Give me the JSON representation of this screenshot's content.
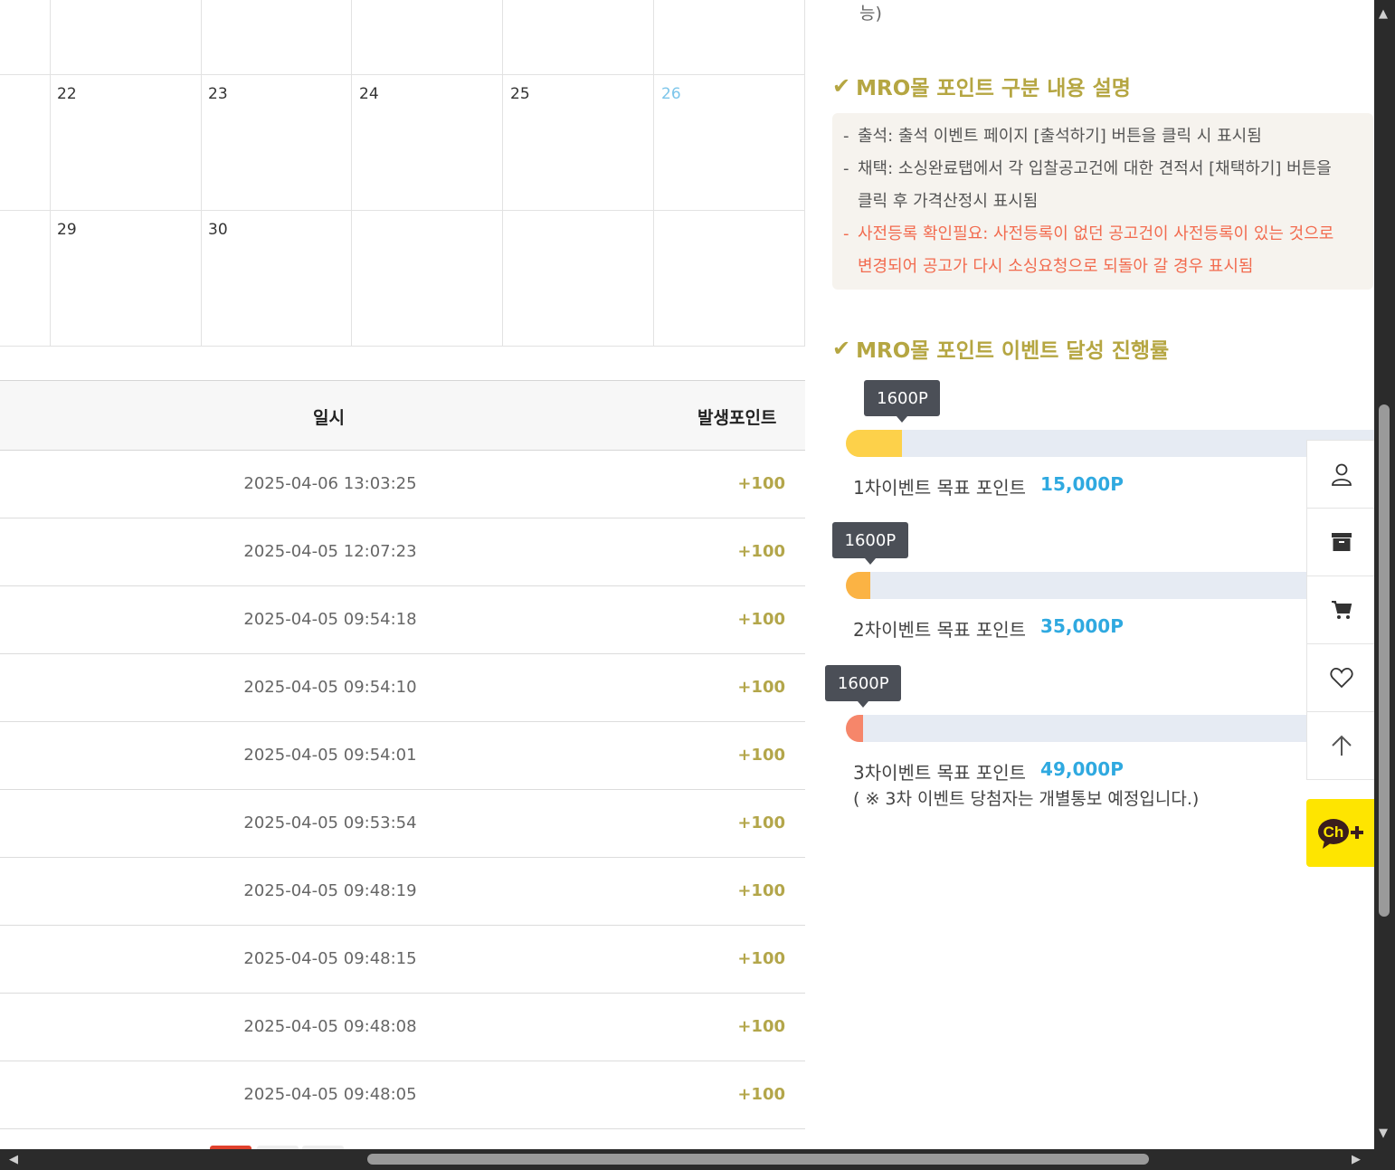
{
  "calendar": {
    "days": [
      "22",
      "23",
      "24",
      "25",
      "26",
      "29",
      "30"
    ]
  },
  "table": {
    "headers": {
      "date": "일시",
      "points": "발생포인트"
    },
    "rows": [
      {
        "date": "2025-04-06 13:03:25",
        "points": "+100"
      },
      {
        "date": "2025-04-05 12:07:23",
        "points": "+100"
      },
      {
        "date": "2025-04-05 09:54:18",
        "points": "+100"
      },
      {
        "date": "2025-04-05 09:54:10",
        "points": "+100"
      },
      {
        "date": "2025-04-05 09:54:01",
        "points": "+100"
      },
      {
        "date": "2025-04-05 09:53:54",
        "points": "+100"
      },
      {
        "date": "2025-04-05 09:48:19",
        "points": "+100"
      },
      {
        "date": "2025-04-05 09:48:15",
        "points": "+100"
      },
      {
        "date": "2025-04-05 09:48:08",
        "points": "+100"
      },
      {
        "date": "2025-04-05 09:48:05",
        "points": "+100"
      }
    ]
  },
  "right": {
    "cut_text": "능)",
    "section1_title": "MRO몰 포인트 구분 내용 설명",
    "desc": [
      {
        "dash": "-",
        "text": "출석: 출석 이벤트 페이지 [출석하기] 버튼을 클릭 시 표시됨"
      },
      {
        "dash": "-",
        "text": "채택: 소싱완료탭에서 각 입찰공고건에 대한 견적서 [채택하기] 버튼을"
      },
      {
        "dash": "",
        "text": "클릭 후 가격산정시 표시됨"
      },
      {
        "dash": "-",
        "text": "사전등록 확인필요: 사전등록이 없던 공고건이 사전등록이 있는 것으로"
      },
      {
        "dash": "",
        "text": "변경되어 공고가 다시 소싱요청으로 되돌아 갈 경우 표시됨"
      }
    ],
    "section2_title": "MRO몰 포인트 이벤트 달성 진행률",
    "events": [
      {
        "tooltip": "1600P",
        "label": "1차이벤트 목표 포인트",
        "goal": "15,000P",
        "progress": 0.107,
        "color": "#fdd14a"
      },
      {
        "tooltip": "1600P",
        "label": "2차이벤트 목표 포인트",
        "goal": "35,000P",
        "progress": 0.046,
        "color": "#fbb344"
      },
      {
        "tooltip": "1600P",
        "label": "3차이벤트 목표 포인트",
        "goal": "49,000P",
        "progress": 0.033,
        "color": "#f6866a"
      }
    ],
    "note": "( ※ 3차 이벤트 당첨자는 개별통보 예정입니다.)"
  },
  "quick_menu": [
    "user-icon",
    "archive-icon",
    "cart-icon",
    "heart-icon",
    "arrow-up-icon"
  ],
  "kakao_label": "Ch"
}
